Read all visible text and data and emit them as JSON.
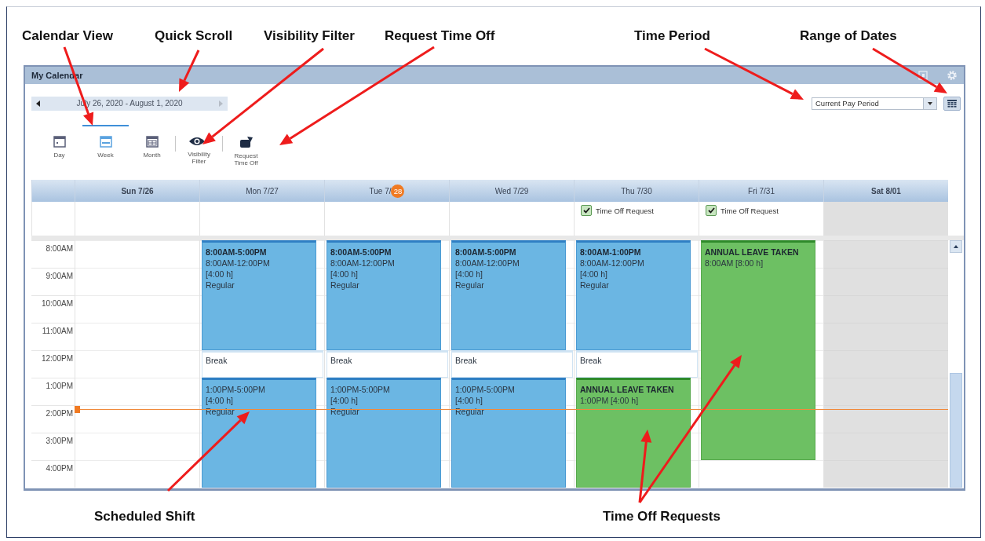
{
  "annotations": {
    "top": [
      {
        "label": "Calendar View"
      },
      {
        "label": "Quick Scroll"
      },
      {
        "label": "Visibility Filter"
      },
      {
        "label": "Request Time Off"
      },
      {
        "label": "Time Period"
      },
      {
        "label": "Range of Dates"
      }
    ],
    "bottom": [
      {
        "label": "Scheduled Shift"
      },
      {
        "label": "Time Off Requests"
      }
    ]
  },
  "window": {
    "title": "My Calendar"
  },
  "date_range": {
    "text": "July 26, 2020 - August 1, 2020"
  },
  "time_period": {
    "value": "Current Pay Period"
  },
  "views": [
    {
      "label": "Day",
      "kind": "day",
      "selected": false
    },
    {
      "label": "Week",
      "kind": "week",
      "selected": true
    },
    {
      "label": "Month",
      "kind": "month",
      "selected": false
    }
  ],
  "actions": [
    {
      "label": "Visibility Filter",
      "kind": "filter"
    },
    {
      "label": "Request Time Off",
      "kind": "request"
    }
  ],
  "times": [
    "8:00AM",
    "9:00AM",
    "10:00AM",
    "11:00AM",
    "12:00PM",
    "1:00PM",
    "2:00PM",
    "3:00PM",
    "4:00PM"
  ],
  "days": [
    {
      "label": "Sun 7/26",
      "weekend": true,
      "shaded": false
    },
    {
      "label": "Mon 7/27",
      "weekend": false,
      "shaded": false,
      "blocks": [
        {
          "kind": "morning-shift",
          "title": "8:00AM-5:00PM",
          "lines": [
            "8:00AM-12:00PM",
            "[4:00 h]",
            "Regular"
          ]
        },
        {
          "kind": "break",
          "lines": [
            "Break"
          ]
        },
        {
          "kind": "afternoon-shift",
          "lines": [
            "1:00PM-5:00PM",
            "[4:00 h]",
            "Regular"
          ]
        }
      ]
    },
    {
      "label": "Tue 7/",
      "today_badge": "28",
      "weekend": false,
      "shaded": false,
      "blocks": [
        {
          "kind": "morning-shift",
          "title": "8:00AM-5:00PM",
          "lines": [
            "8:00AM-12:00PM",
            "[4:00 h]",
            "Regular"
          ]
        },
        {
          "kind": "break",
          "lines": [
            "Break"
          ]
        },
        {
          "kind": "afternoon-shift",
          "lines": [
            "1:00PM-5:00PM",
            "[4:00 h]",
            "Regular"
          ]
        }
      ]
    },
    {
      "label": "Wed 7/29",
      "weekend": false,
      "shaded": false,
      "blocks": [
        {
          "kind": "morning-shift",
          "title": "8:00AM-5:00PM",
          "lines": [
            "8:00AM-12:00PM",
            "[4:00 h]",
            "Regular"
          ]
        },
        {
          "kind": "break",
          "lines": [
            "Break"
          ]
        },
        {
          "kind": "afternoon-shift",
          "lines": [
            "1:00PM-5:00PM",
            "[4:00 h]",
            "Regular"
          ]
        }
      ]
    },
    {
      "label": "Thu 7/30",
      "weekend": false,
      "shaded": false,
      "all_day": {
        "label": "Time Off Request",
        "checked": true
      },
      "blocks": [
        {
          "kind": "morning-shift",
          "title": "8:00AM-1:00PM",
          "lines": [
            "8:00AM-12:00PM",
            "[4:00 h]",
            "Regular"
          ]
        },
        {
          "kind": "break",
          "lines": [
            "Break"
          ]
        },
        {
          "kind": "afternoon-leave",
          "title": "ANNUAL LEAVE TAKEN",
          "lines": [
            "1:00PM [4:00 h]"
          ]
        }
      ]
    },
    {
      "label": "Fri 7/31",
      "weekend": false,
      "shaded": false,
      "all_day": {
        "label": "Time Off Request",
        "checked": true
      },
      "blocks": [
        {
          "kind": "full-day-leave",
          "title": "ANNUAL LEAVE TAKEN",
          "lines": [
            "8:00AM [8:00 h]"
          ]
        }
      ]
    },
    {
      "label": "Sat 8/01",
      "weekend": true,
      "shaded": true
    }
  ]
}
